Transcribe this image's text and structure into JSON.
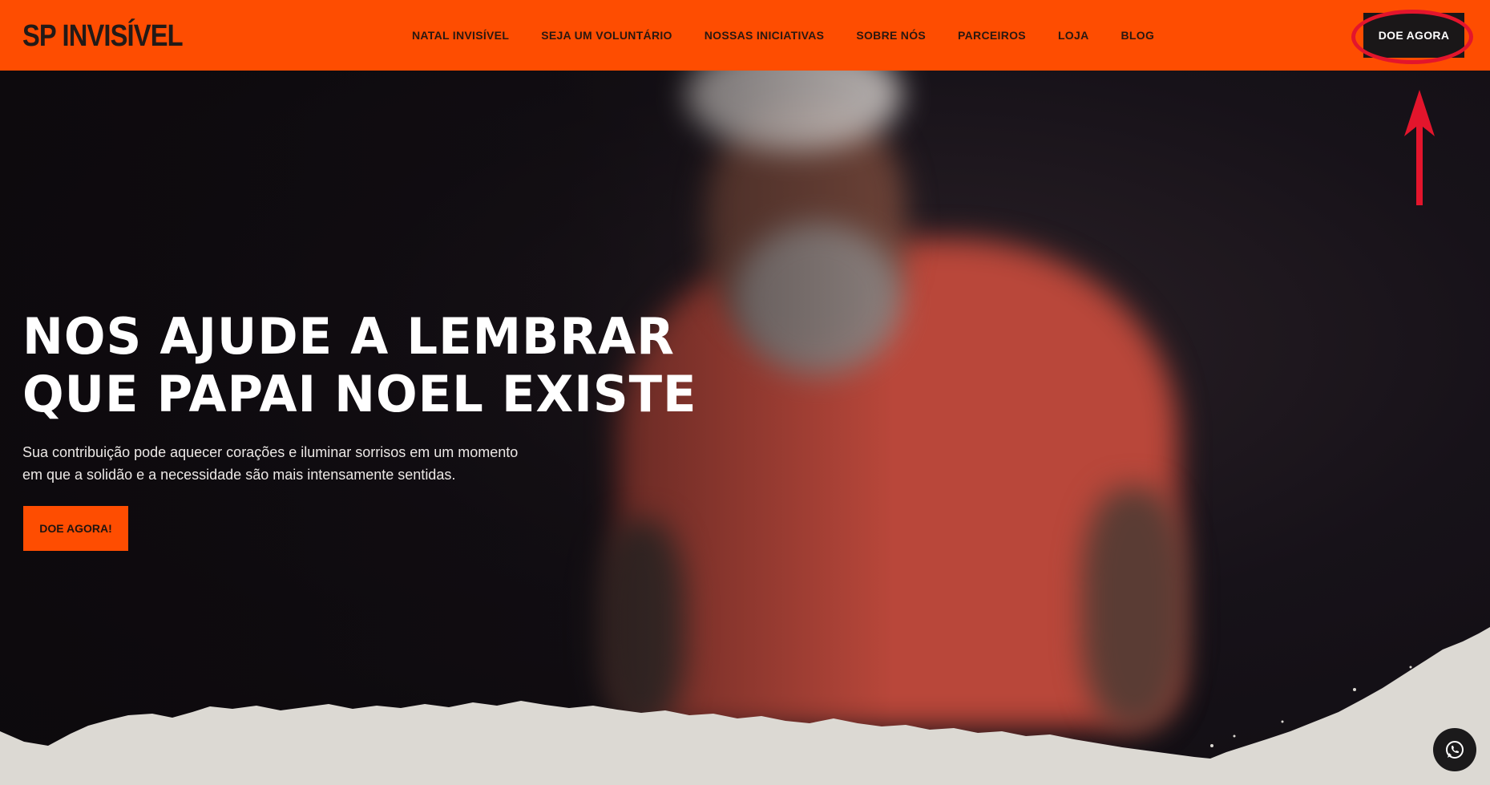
{
  "brand": {
    "logo_text": "SP INVISÍVEL"
  },
  "nav": {
    "items": [
      {
        "label": "NATAL INVISÍVEL"
      },
      {
        "label": "SEJA UM VOLUNTÁRIO"
      },
      {
        "label": "NOSSAS INICIATIVAS"
      },
      {
        "label": "SOBRE NÓS"
      },
      {
        "label": "PARCEIROS"
      },
      {
        "label": "LOJA"
      },
      {
        "label": "BLOG"
      }
    ],
    "donate_label": "DOE AGORA"
  },
  "hero": {
    "headline_line1": "NOS AJUDE A LEMBRAR",
    "headline_line2": "QUE PAPAI NOEL EXISTE",
    "description_line1": "Sua contribuição pode aquecer corações e iluminar sorrisos em um momento",
    "description_line2": "em que a solidão e a necessidade são mais intensamente sentidas.",
    "cta_label": "DOE AGORA!"
  },
  "floating": {
    "icon": "whatsapp-icon"
  },
  "colors": {
    "brand_orange": "#fe4d01",
    "dark": "#1a1718",
    "annotation_red": "#e3152c",
    "paper": "#dcd9d3"
  }
}
